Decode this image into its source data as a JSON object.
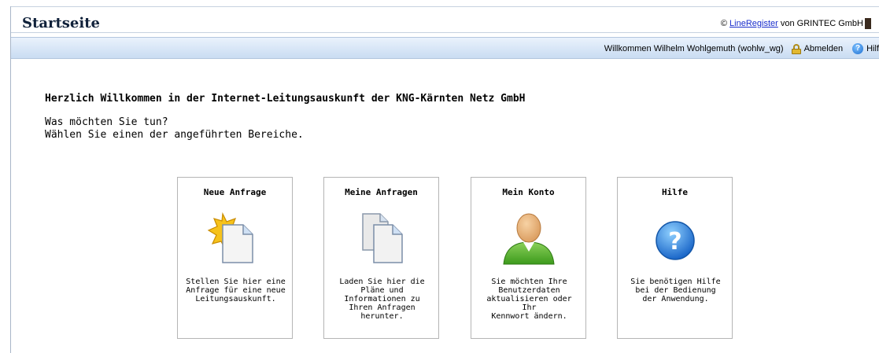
{
  "header": {
    "title": "Startseite",
    "copyright_prefix": "©",
    "link_text": "LineRegister",
    "copyright_suffix": "von GRINTEC GmbH"
  },
  "userbar": {
    "welcome": "Willkommen Wilhelm Wohlgemuth (wohlw_wg)",
    "logout_label": "Abmelden",
    "help_label": "Hilf"
  },
  "main": {
    "heading": "Herzlich Willkommen in der Internet-Leitungsauskunft der KNG-Kärnten Netz GmbH",
    "line1": "Was möchten Sie tun?",
    "line2": "Wählen Sie einen der angeführten Bereiche."
  },
  "tiles": [
    {
      "title": "Neue Anfrage",
      "icon": "new-document-star-icon",
      "description": "Stellen Sie hier eine\nAnfrage für eine neue\nLeitungsauskunft."
    },
    {
      "title": "Meine Anfragen",
      "icon": "documents-icon",
      "description": "Laden Sie hier die\nPläne und\nInformationen zu\nIhren Anfragen\nherunter."
    },
    {
      "title": "Mein Konto",
      "icon": "user-account-icon",
      "description": "Sie möchten Ihre\nBenutzerdaten\naktualisieren oder Ihr\nKennwort ändern."
    },
    {
      "title": "Hilfe",
      "icon": "help-icon",
      "description": "Sie benötigen Hilfe\nbei der Bedienung\nder Anwendung."
    }
  ],
  "colors": {
    "link": "#1a2ecc",
    "bar_gradient_top": "#eaf2fc",
    "bar_gradient_bottom": "#c9dcf2",
    "help_blue": "#1d6fd1"
  }
}
